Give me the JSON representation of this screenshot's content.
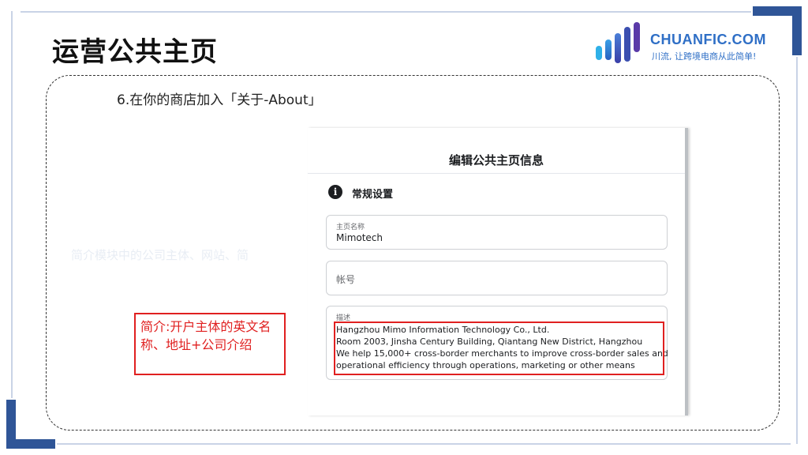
{
  "slide": {
    "title": "运营公共主页",
    "step": "6.在你的商店加入「关于-About」",
    "ghost_text": "简介模块中的公司主体、网站、简"
  },
  "logo": {
    "name": "CHUANFIC.COM",
    "tagline": "川流, 让跨境电商从此简单!",
    "icon": "bar-chart-logo-icon"
  },
  "panel": {
    "title": "编辑公共主页信息",
    "section": {
      "icon": "info-icon",
      "icon_glyph": "i",
      "title": "常规设置"
    },
    "fields": {
      "page_name": {
        "label": "主页名称",
        "value": "Mimotech"
      },
      "account": {
        "placeholder": "帐号"
      },
      "description": {
        "label": "描述",
        "lines": [
          "Hangzhou Mimo Information Technology Co., Ltd.",
          "Room 2003, Jinsha Century Building, Qiantang New District, Hangzhou",
          "We help 15,000+ cross-border merchants to improve cross-border sales and",
          "operational efficiency through operations, marketing or other means"
        ]
      }
    }
  },
  "annotation": {
    "text": "简介:开户主体的英文名称、地址+公司介绍"
  },
  "colors": {
    "accent": "#2f5597",
    "brand": "#2f6fc6",
    "highlight": "#e02020"
  }
}
